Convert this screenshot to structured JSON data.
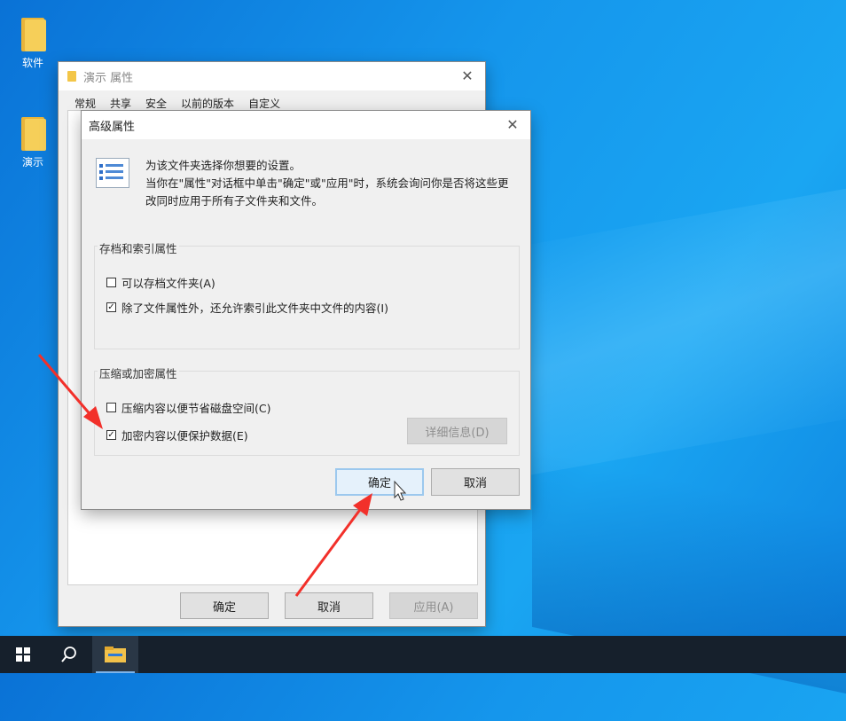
{
  "desktop": {
    "icons": [
      {
        "label": "软件"
      },
      {
        "label": "演示"
      }
    ]
  },
  "properties_window": {
    "title": "演示 属性",
    "tabs": [
      "常规",
      "共享",
      "安全",
      "以前的版本",
      "自定义"
    ],
    "buttons": {
      "ok": "确定",
      "cancel": "取消",
      "apply": "应用(A)"
    }
  },
  "advanced_dialog": {
    "title": "高级属性",
    "description_line1": "为该文件夹选择你想要的设置。",
    "description_line2": "当你在\"属性\"对话框中单击\"确定\"或\"应用\"时，系统会询问你是否将这些更改同时应用于所有子文件夹和文件。",
    "archive_group": {
      "label": "存档和索引属性",
      "options": [
        {
          "label": "可以存档文件夹(A)",
          "checked": false
        },
        {
          "label": "除了文件属性外，还允许索引此文件夹中文件的内容(I)",
          "checked": true
        }
      ]
    },
    "compress_group": {
      "label": "压缩或加密属性",
      "options": [
        {
          "label": "压缩内容以便节省磁盘空间(C)",
          "checked": false
        },
        {
          "label": "加密内容以便保护数据(E)",
          "checked": true
        }
      ],
      "details_button": "详细信息(D)"
    },
    "buttons": {
      "ok": "确定",
      "cancel": "取消"
    }
  },
  "colors": {
    "annotation_arrow": "#f2302a",
    "accent": "#0078d7"
  }
}
